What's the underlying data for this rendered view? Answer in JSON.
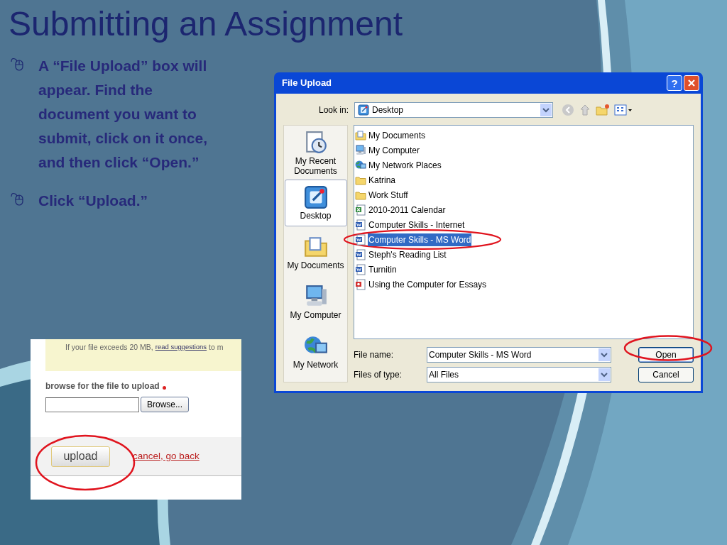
{
  "slide": {
    "title": "Submitting an Assignment",
    "bullets": [
      "A “File Upload” box will appear. Find the document you want to submit, click on it once, and then click “Open.”",
      "Click “Upload.”"
    ]
  },
  "dialog": {
    "title": "File Upload",
    "help_button": "?",
    "look_in_label": "Look in:",
    "look_in_value": "Desktop",
    "places": [
      {
        "label": "My Recent Documents",
        "kind": "recent",
        "selected": false
      },
      {
        "label": "Desktop",
        "kind": "desktop",
        "selected": true
      },
      {
        "label": "My Documents",
        "kind": "mydocs",
        "selected": false
      },
      {
        "label": "My Computer",
        "kind": "computer",
        "selected": false
      },
      {
        "label": "My Network",
        "kind": "network",
        "selected": false
      }
    ],
    "files": [
      {
        "name": "My Documents",
        "kind": "mydocs",
        "selected": false
      },
      {
        "name": "My Computer",
        "kind": "computer",
        "selected": false
      },
      {
        "name": "My Network Places",
        "kind": "network",
        "selected": false
      },
      {
        "name": "Katrina",
        "kind": "folder",
        "selected": false
      },
      {
        "name": "Work Stuff",
        "kind": "folder",
        "selected": false
      },
      {
        "name": "2010-2011 Calendar",
        "kind": "excel",
        "selected": false
      },
      {
        "name": "Computer Skills - Internet",
        "kind": "word",
        "selected": false
      },
      {
        "name": "Computer Skills - MS Word",
        "kind": "word",
        "selected": true
      },
      {
        "name": "Steph's Reading List",
        "kind": "word",
        "selected": false
      },
      {
        "name": "Turnitin",
        "kind": "word",
        "selected": false
      },
      {
        "name": "Using the Computer for Essays",
        "kind": "pdf",
        "selected": false
      }
    ],
    "file_name_label": "File name:",
    "file_name_value": "Computer Skills - MS Word",
    "file_type_label": "Files of type:",
    "file_type_value": "All Files",
    "buttons": [
      "Open",
      "Cancel"
    ]
  },
  "web_form": {
    "notice": "If your file exceeds 20 MB,",
    "notice_link": "read suggestions",
    "notice_tail": "to m",
    "field_label": "browse for the file to upload",
    "browse_button": "Browse...",
    "upload_button": "upload",
    "cancel_link": "cancel, go back"
  }
}
